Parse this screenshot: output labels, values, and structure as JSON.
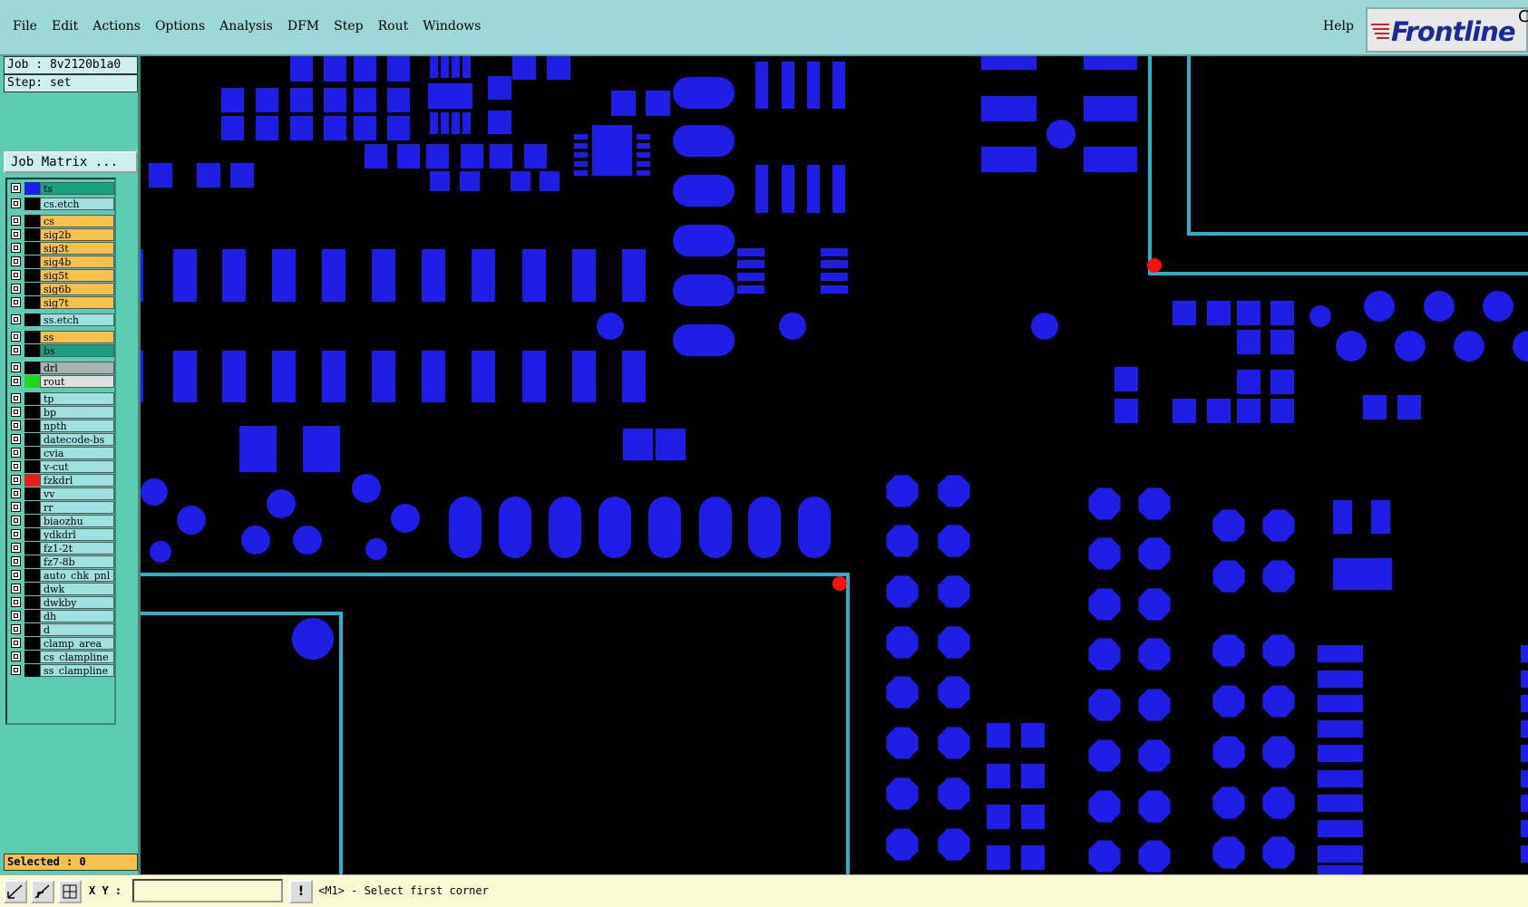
{
  "menubar": {
    "items": [
      "File",
      "Edit",
      "Actions",
      "Options",
      "Analysis",
      "DFM",
      "Step",
      "Rout",
      "Windows"
    ],
    "help": "Help"
  },
  "logo": {
    "text": "Frontline",
    "corner": "C"
  },
  "job": {
    "job_line": "Job : 8v2120b1a0",
    "step_line": "Step: set"
  },
  "job_matrix_button": "Job Matrix ...",
  "layers": [
    {
      "name": "ts",
      "bg": "#1a9f7f",
      "swatch": "#1e1ee8"
    },
    {
      "name": "cs.etch",
      "bg": "#9fe0e0",
      "swatch": "#000000"
    },
    {
      "name": "cs",
      "bg": "#f7c04a",
      "swatch": "#000000"
    },
    {
      "name": "sig2b",
      "bg": "#f7c04a",
      "swatch": "#000000"
    },
    {
      "name": "sig3t",
      "bg": "#f7c04a",
      "swatch": "#000000"
    },
    {
      "name": "sig4b",
      "bg": "#f7c04a",
      "swatch": "#000000"
    },
    {
      "name": "sig5t",
      "bg": "#f7c04a",
      "swatch": "#000000"
    },
    {
      "name": "sig6b",
      "bg": "#f7c04a",
      "swatch": "#000000"
    },
    {
      "name": "sig7t",
      "bg": "#f7c04a",
      "swatch": "#000000"
    },
    {
      "name": "ss.etch",
      "bg": "#9fe0e0",
      "swatch": "#000000"
    },
    {
      "name": "ss",
      "bg": "#f7c04a",
      "swatch": "#000000"
    },
    {
      "name": "bs",
      "bg": "#1a9f7f",
      "swatch": "#000000"
    },
    {
      "name": "drl",
      "bg": "#a8b4b4",
      "swatch": "#000000"
    },
    {
      "name": "rout",
      "bg": "#e0e0e0",
      "swatch": "#1ed81e"
    },
    {
      "name": "tp",
      "bg": "#9fe0e0",
      "swatch": "#000000"
    },
    {
      "name": "bp",
      "bg": "#9fe0e0",
      "swatch": "#000000"
    },
    {
      "name": "npth",
      "bg": "#9fe0e0",
      "swatch": "#000000"
    },
    {
      "name": "datecode-bs",
      "bg": "#9fe0e0",
      "swatch": "#000000"
    },
    {
      "name": "cvia",
      "bg": "#9fe0e0",
      "swatch": "#000000"
    },
    {
      "name": "v-cut",
      "bg": "#9fe0e0",
      "swatch": "#000000"
    },
    {
      "name": "fzkdrl",
      "bg": "#9fe0e0",
      "swatch": "#e81e1e"
    },
    {
      "name": "vv",
      "bg": "#9fe0e0",
      "swatch": "#000000"
    },
    {
      "name": "rr",
      "bg": "#9fe0e0",
      "swatch": "#000000"
    },
    {
      "name": "biaozhu",
      "bg": "#9fe0e0",
      "swatch": "#000000"
    },
    {
      "name": "ydkdrl",
      "bg": "#9fe0e0",
      "swatch": "#000000"
    },
    {
      "name": "fz1-2t",
      "bg": "#9fe0e0",
      "swatch": "#000000"
    },
    {
      "name": "fz7-8b",
      "bg": "#9fe0e0",
      "swatch": "#000000"
    },
    {
      "name": "auto_chk_pnl",
      "bg": "#9fe0e0",
      "swatch": "#000000"
    },
    {
      "name": "dwk",
      "bg": "#9fe0e0",
      "swatch": "#000000"
    },
    {
      "name": "dwkby",
      "bg": "#9fe0e0",
      "swatch": "#000000"
    },
    {
      "name": "dh",
      "bg": "#9fe0e0",
      "swatch": "#000000"
    },
    {
      "name": "d",
      "bg": "#9fe0e0",
      "swatch": "#000000"
    },
    {
      "name": "clamp_area",
      "bg": "#9fe0e0",
      "swatch": "#000000"
    },
    {
      "name": "cs_clampline",
      "bg": "#9fe0e0",
      "swatch": "#000000"
    },
    {
      "name": "ss_clampline",
      "bg": "#9fe0e0",
      "swatch": "#000000"
    }
  ],
  "selected_label": "Selected : 0",
  "statusbar": {
    "xy_label": "X Y :",
    "xy_value": "",
    "warn_label": "!",
    "prompt": "<M1> - Select first corner"
  },
  "colors": {
    "pad": "#1e1ee8",
    "rout": "#2bb0c8",
    "marker": "#ff1010",
    "background": "#000000"
  }
}
